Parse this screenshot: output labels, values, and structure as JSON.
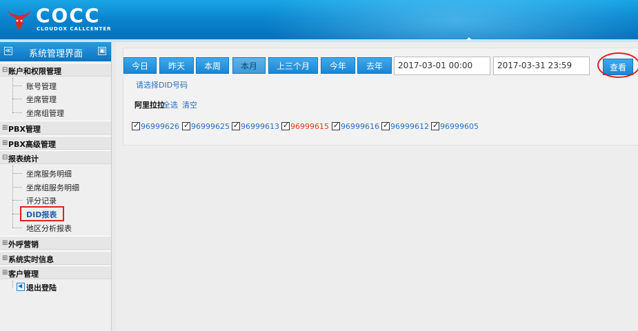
{
  "header": {
    "logo": "COCC",
    "logo_sub": "CLOUDOX CALLCENTER"
  },
  "sidebar": {
    "title": "系统管理界面",
    "collapse_left": "≪",
    "collapse_right": "▣",
    "groups": [
      {
        "label": "账户和权限管理",
        "expand": "⊟",
        "items": [
          "账号管理",
          "坐席管理",
          "坐席组管理"
        ]
      },
      {
        "label": "PBX管理",
        "expand": "⊞",
        "items": []
      },
      {
        "label": "PBX高级管理",
        "expand": "⊞",
        "items": []
      },
      {
        "label": "报表统计",
        "expand": "⊟",
        "items": [
          "坐席服务明细",
          "坐席组服务明细",
          "评分记录",
          "DID报表",
          "地区分析报表"
        ]
      },
      {
        "label": "外呼营销",
        "expand": "⊞",
        "items": []
      },
      {
        "label": "系统实时信息",
        "expand": "⊞",
        "items": []
      },
      {
        "label": "客户管理",
        "expand": "⊞",
        "items": []
      }
    ],
    "logout": "退出登陆",
    "active_item": "DID报表",
    "active_color": "#1a5fb4"
  },
  "toolbar": {
    "buttons": [
      "今日",
      "昨天",
      "本周",
      "本月",
      "上三个月",
      "今年",
      "去年"
    ],
    "active_button": "本月",
    "start_date": "2017-03-01 00:00",
    "end_date": "2017-03-31 23:59",
    "query": "查看"
  },
  "did": {
    "hint": "请选择DID号码",
    "group_name": "阿里拉拉",
    "select_all": "全选",
    "clear": "清空",
    "numbers": [
      {
        "value": "96999626",
        "checked": true,
        "color": "#2a6ec0"
      },
      {
        "value": "96999625",
        "checked": true,
        "color": "#2a6ec0"
      },
      {
        "value": "96999613",
        "checked": true,
        "color": "#2a6ec0"
      },
      {
        "value": "96999615",
        "checked": true,
        "color": "#e03a1a"
      },
      {
        "value": "96999616",
        "checked": true,
        "color": "#2a6ec0"
      },
      {
        "value": "96999612",
        "checked": true,
        "color": "#2a6ec0"
      },
      {
        "value": "96999605",
        "checked": true,
        "color": "#2a6ec0"
      }
    ]
  },
  "colors": {
    "header_blue": "#0a86cf",
    "button_blue": "#1a86d4",
    "annotation_red": "#e02020"
  }
}
